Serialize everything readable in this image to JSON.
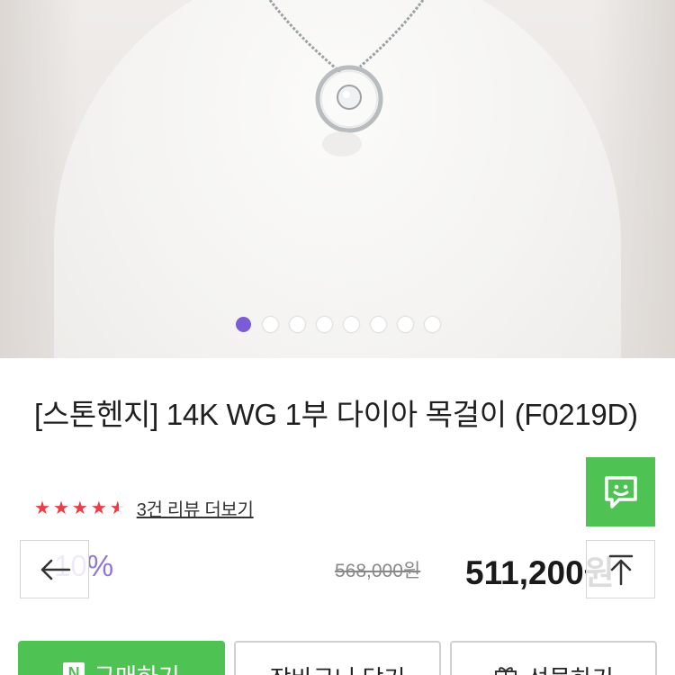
{
  "product": {
    "title": "[스톤헨지] 14K WG 1부 다이아 목걸이 (F0219D)",
    "rating": 4.5,
    "rating_max": 5,
    "review_link": "3건 리뷰 더보기",
    "discount": "10%",
    "original_price": "568,000원",
    "sale_price": "511,200원"
  },
  "carousel": {
    "total": 8,
    "active_index": 0
  },
  "actions": {
    "buy_label": "구매하기",
    "cart_label": "장바구니 담기",
    "gift_label": "선물하기"
  },
  "icons": {
    "chat": "chat-icon",
    "back": "arrow-left-icon",
    "top": "arrow-up-icon",
    "gift": "gift-icon",
    "naver": "naver-n-icon"
  },
  "colors": {
    "accent_green": "#4fc254",
    "accent_purple": "#7b5cd6",
    "star_red": "#ef3b46"
  }
}
